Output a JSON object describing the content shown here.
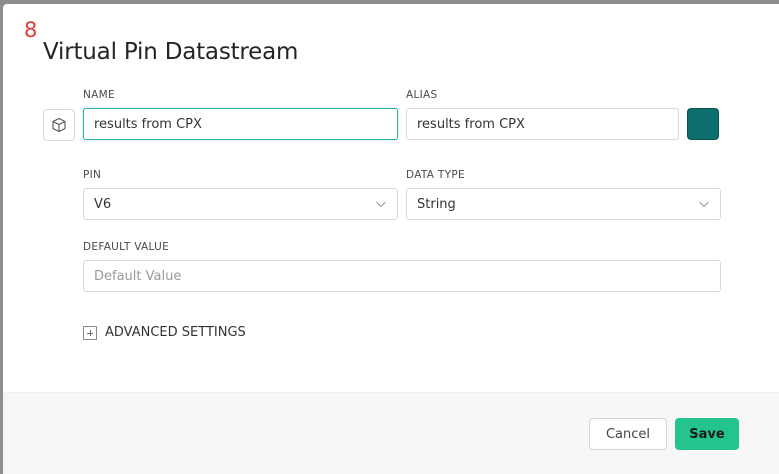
{
  "dialog": {
    "step_number": "8",
    "title": "Virtual Pin Datastream"
  },
  "form": {
    "name_label": "NAME",
    "name_value": "results from CPX",
    "alias_label": "ALIAS",
    "alias_value": "results from CPX",
    "color": "#0d6e6e",
    "pin_label": "PIN",
    "pin_value": "V6",
    "data_type_label": "DATA TYPE",
    "data_type_value": "String",
    "default_value_label": "DEFAULT VALUE",
    "default_value_placeholder": "Default Value",
    "advanced_settings_label": "ADVANCED SETTINGS"
  },
  "footer": {
    "cancel_label": "Cancel",
    "save_label": "Save"
  },
  "colors": {
    "accent": "#23c48e",
    "focus_border": "#2bb5a0",
    "step_number": "#e53935"
  }
}
